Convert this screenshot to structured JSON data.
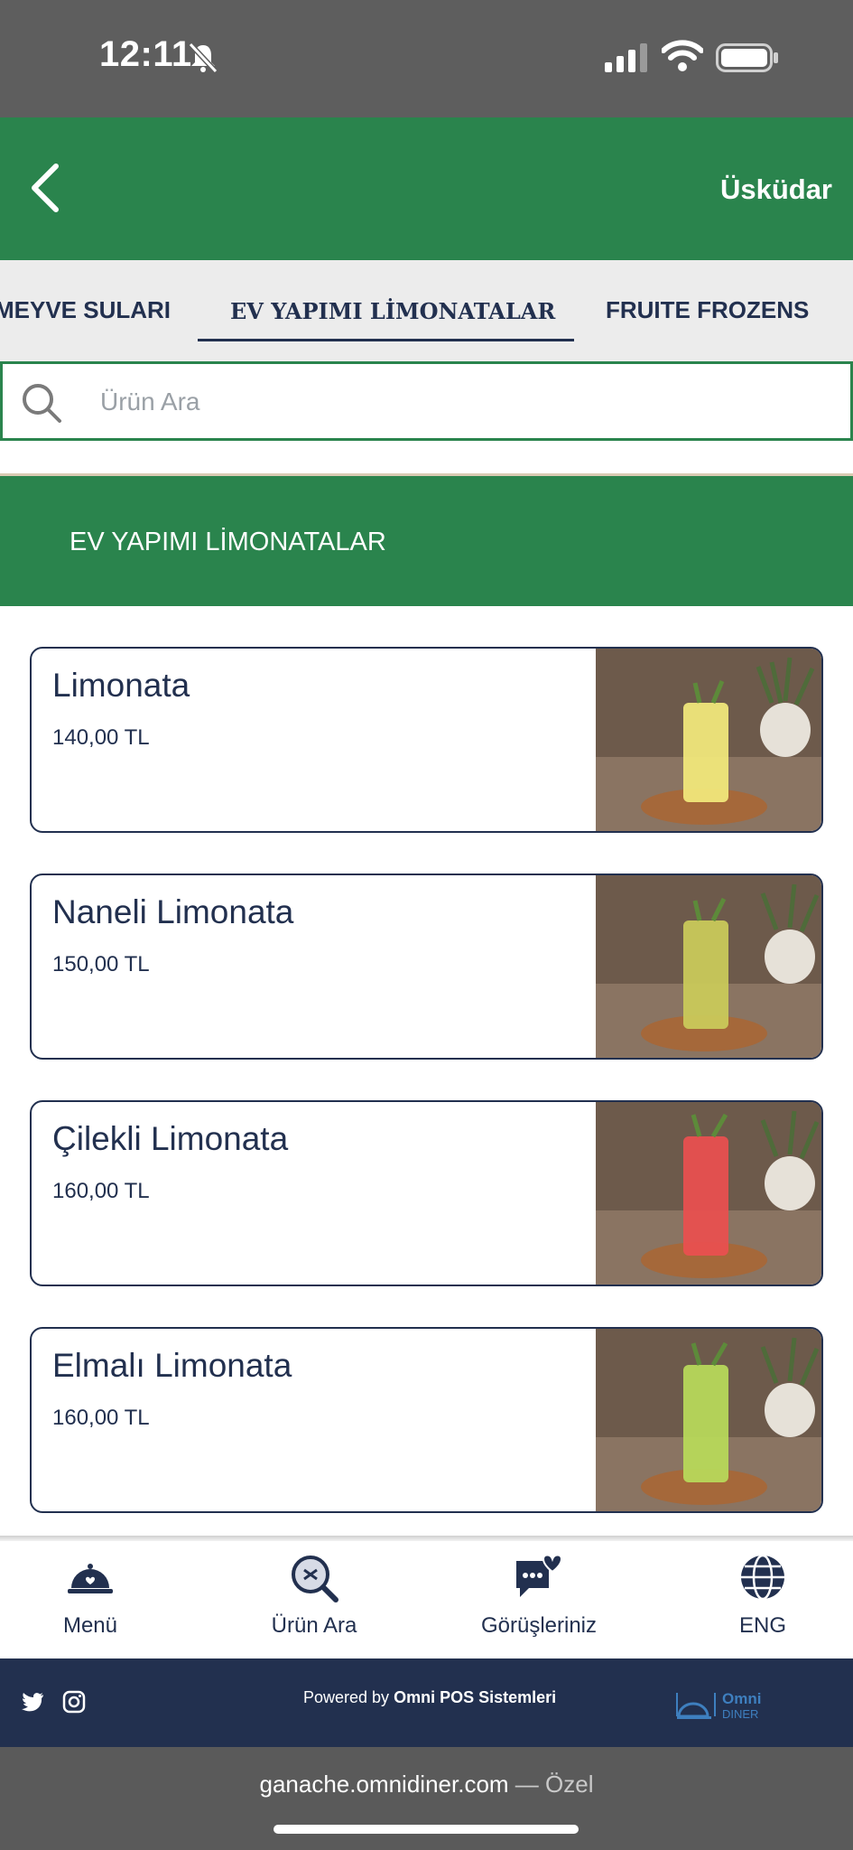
{
  "status_bar": {
    "time": "12:11"
  },
  "header": {
    "location": "Üsküdar"
  },
  "tabs": [
    {
      "label": "MEYVE SULARI"
    },
    {
      "label": "EV YAPIMI LİMONATALAR",
      "active": true
    },
    {
      "label": "FRUITE FROZENS"
    }
  ],
  "search": {
    "placeholder": "Ürün Ara",
    "value": ""
  },
  "section": {
    "title": "EV YAPIMI LİMONATALAR"
  },
  "products": [
    {
      "name": "Limonata",
      "price": "140,00 TL",
      "drink_color": "#f0e77a"
    },
    {
      "name": "Naneli Limonata",
      "price": "150,00 TL",
      "drink_color": "#c9c95a"
    },
    {
      "name": "Çilekli Limonata",
      "price": "160,00 TL",
      "drink_color": "#e8504f"
    },
    {
      "name": "Elmalı Limonata",
      "price": "160,00 TL",
      "drink_color": "#b7d85a"
    }
  ],
  "bottom_nav": [
    {
      "label": "Menü",
      "icon": "cloche-icon"
    },
    {
      "label": "Ürün Ara",
      "icon": "search-icon"
    },
    {
      "label": "Görüşleriniz",
      "icon": "feedback-heart-icon"
    },
    {
      "label": "ENG",
      "icon": "globe-icon"
    }
  ],
  "footer": {
    "powered_prefix": "Powered by ",
    "powered_brand": "Omni POS Sistemleri",
    "logo_top": "Omni",
    "logo_bottom": "DINER"
  },
  "browser": {
    "domain": "ganache.omnidiner.com",
    "suffix": " — Özel"
  },
  "colors": {
    "brand_green": "#2a844d",
    "navy": "#22304f",
    "tab_bg": "#ececec"
  }
}
